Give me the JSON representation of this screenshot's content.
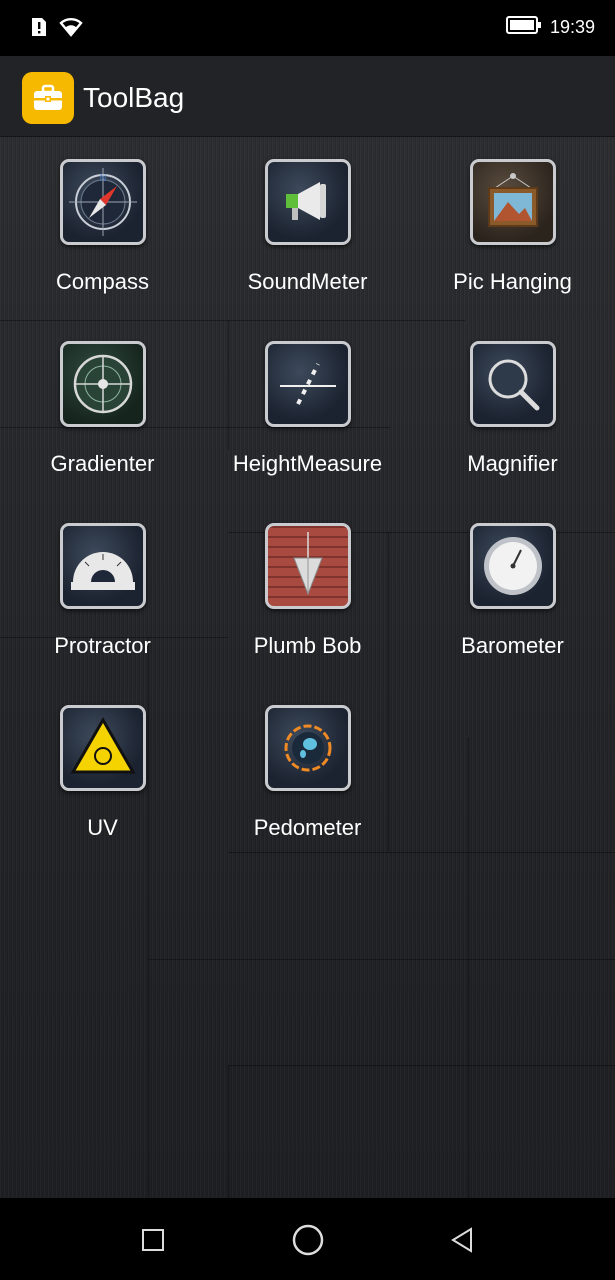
{
  "status_bar": {
    "time": "19:39",
    "icons": [
      "sim-alert-icon",
      "wifi-icon",
      "battery-icon"
    ]
  },
  "app_bar": {
    "title": "ToolBag",
    "icon": "toolbox-icon",
    "icon_color": "#f7b900"
  },
  "tools": [
    {
      "label": "Compass",
      "icon": "compass-icon"
    },
    {
      "label": "SoundMeter",
      "icon": "megaphone-icon"
    },
    {
      "label": "Pic Hanging",
      "icon": "picture-frame-icon"
    },
    {
      "label": "Gradienter",
      "icon": "level-icon"
    },
    {
      "label": "HeightMeasure",
      "icon": "height-measure-icon"
    },
    {
      "label": "Magnifier",
      "icon": "magnifier-icon"
    },
    {
      "label": "Protractor",
      "icon": "protractor-icon"
    },
    {
      "label": "Plumb Bob",
      "icon": "plumb-bob-icon"
    },
    {
      "label": "Barometer",
      "icon": "barometer-icon"
    },
    {
      "label": "UV",
      "icon": "uv-warning-icon"
    },
    {
      "label": "Pedometer",
      "icon": "pedometer-icon"
    }
  ],
  "nav_bar": {
    "buttons": [
      "recents-icon",
      "home-icon",
      "back-icon"
    ]
  }
}
